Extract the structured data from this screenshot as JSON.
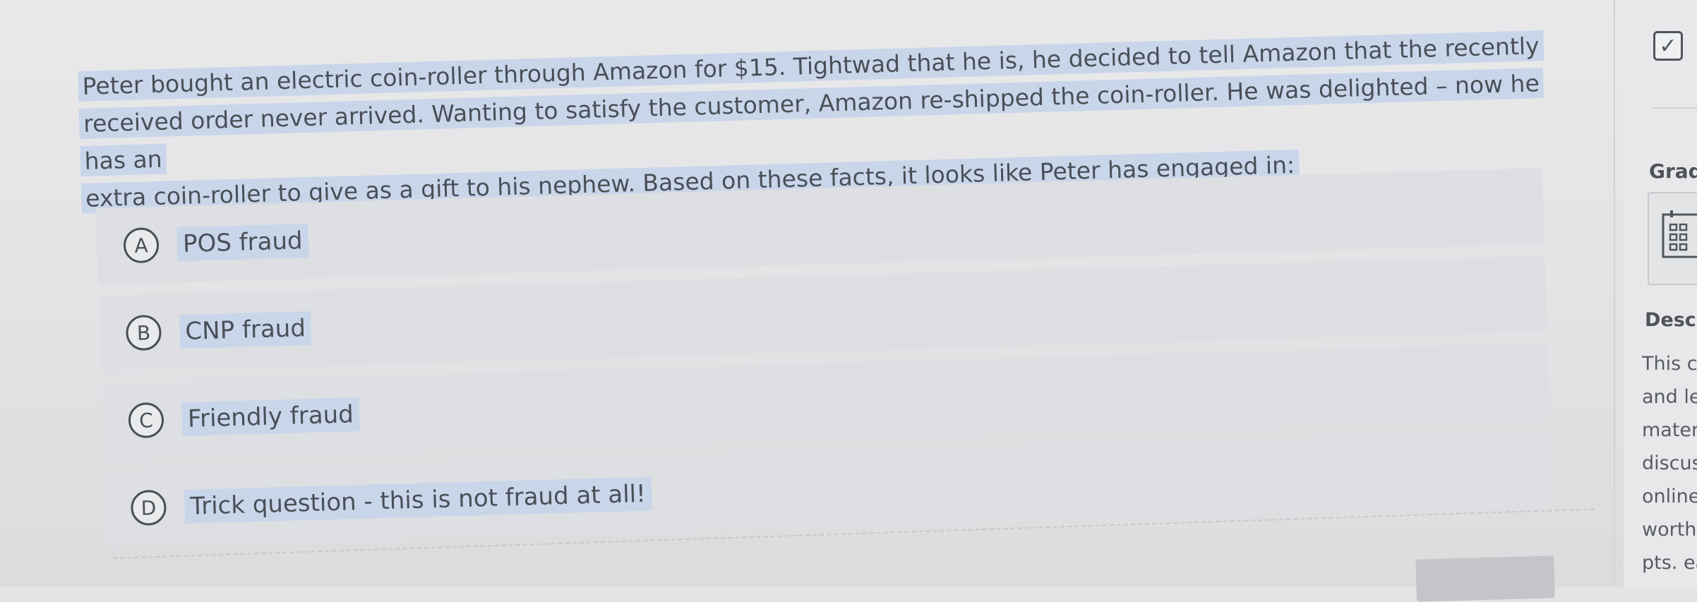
{
  "question": {
    "lines": [
      "Peter bought an electric coin-roller through Amazon for $15. Tightwad that he is, he decided to tell Amazon that the recently",
      "received order never arrived. Wanting to satisfy the customer, Amazon re-shipped the coin-roller. He was delighted – now he has an",
      "extra coin-roller to give as a gift to his nephew. Based on these facts, it looks like Peter has engaged in:"
    ]
  },
  "options": [
    {
      "letter": "A",
      "text": "POS fraud"
    },
    {
      "letter": "B",
      "text": "CNP fraud"
    },
    {
      "letter": "C",
      "text": "Friendly fraud"
    },
    {
      "letter": "D",
      "text": "Trick question - this is not fraud at all!"
    }
  ],
  "side_panel": {
    "grade_label": "Grad",
    "description_label": "Desc",
    "description_lines": [
      "This c",
      "and le",
      "mater",
      "discus",
      "online",
      "worth",
      "pts. ea"
    ]
  },
  "icons": {
    "checkbox": "checkbox-check-icon",
    "calendar": "calendar-icon"
  },
  "colors": {
    "highlight": "#c9d6ea",
    "text": "#4a4f57",
    "option_bg": "#dedfe2"
  }
}
